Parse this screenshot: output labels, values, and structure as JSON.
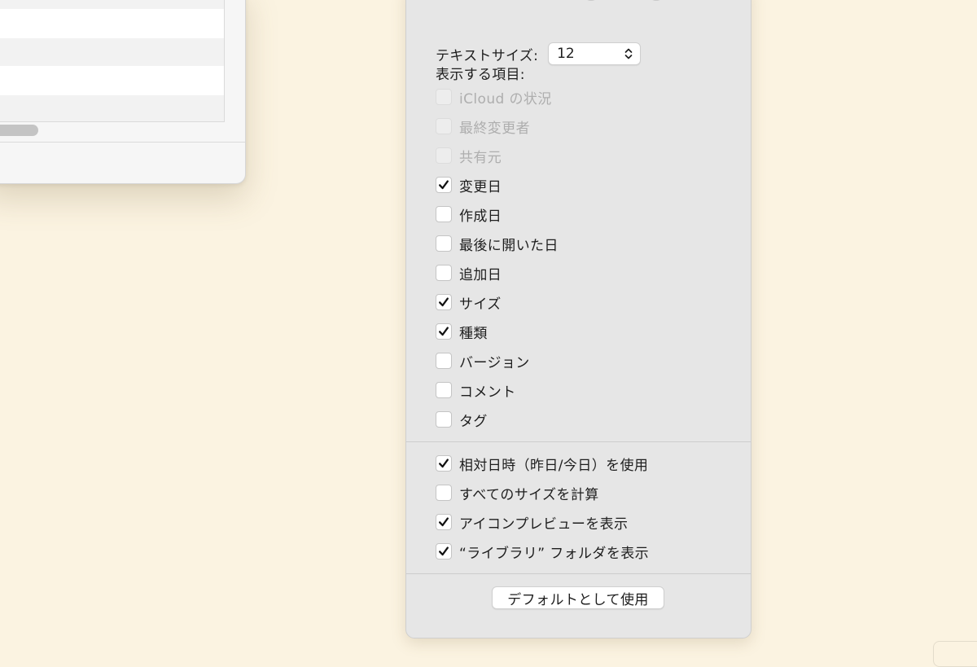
{
  "text_size": {
    "label": "テキストサイズ:",
    "value": "12"
  },
  "columns": {
    "label": "表示する項目:",
    "items": [
      {
        "label": "iCloud の状況",
        "checked": false,
        "enabled": false
      },
      {
        "label": "最終変更者",
        "checked": false,
        "enabled": false
      },
      {
        "label": "共有元",
        "checked": false,
        "enabled": false
      },
      {
        "label": "変更日",
        "checked": true,
        "enabled": true
      },
      {
        "label": "作成日",
        "checked": false,
        "enabled": true
      },
      {
        "label": "最後に開いた日",
        "checked": false,
        "enabled": true
      },
      {
        "label": "追加日",
        "checked": false,
        "enabled": true
      },
      {
        "label": "サイズ",
        "checked": true,
        "enabled": true
      },
      {
        "label": "種類",
        "checked": true,
        "enabled": true
      },
      {
        "label": "バージョン",
        "checked": false,
        "enabled": true
      },
      {
        "label": "コメント",
        "checked": false,
        "enabled": true
      },
      {
        "label": "タグ",
        "checked": false,
        "enabled": true
      }
    ]
  },
  "options": {
    "items": [
      {
        "label": "相対日時（昨日/今日）を使用",
        "checked": true,
        "enabled": true
      },
      {
        "label": "すべてのサイズを計算",
        "checked": false,
        "enabled": true
      },
      {
        "label": "アイコンプレビューを表示",
        "checked": true,
        "enabled": true
      },
      {
        "label": "“ライブラリ” フォルダを表示",
        "checked": true,
        "enabled": true
      }
    ]
  },
  "default_button": {
    "label": "デフォルトとして使用"
  },
  "colors": {
    "desktop": "#FBF3E1",
    "panel": "#E6E6E6",
    "checkbox_fill": "#FFFFFF",
    "disabled_text": "#AEAEAE"
  }
}
